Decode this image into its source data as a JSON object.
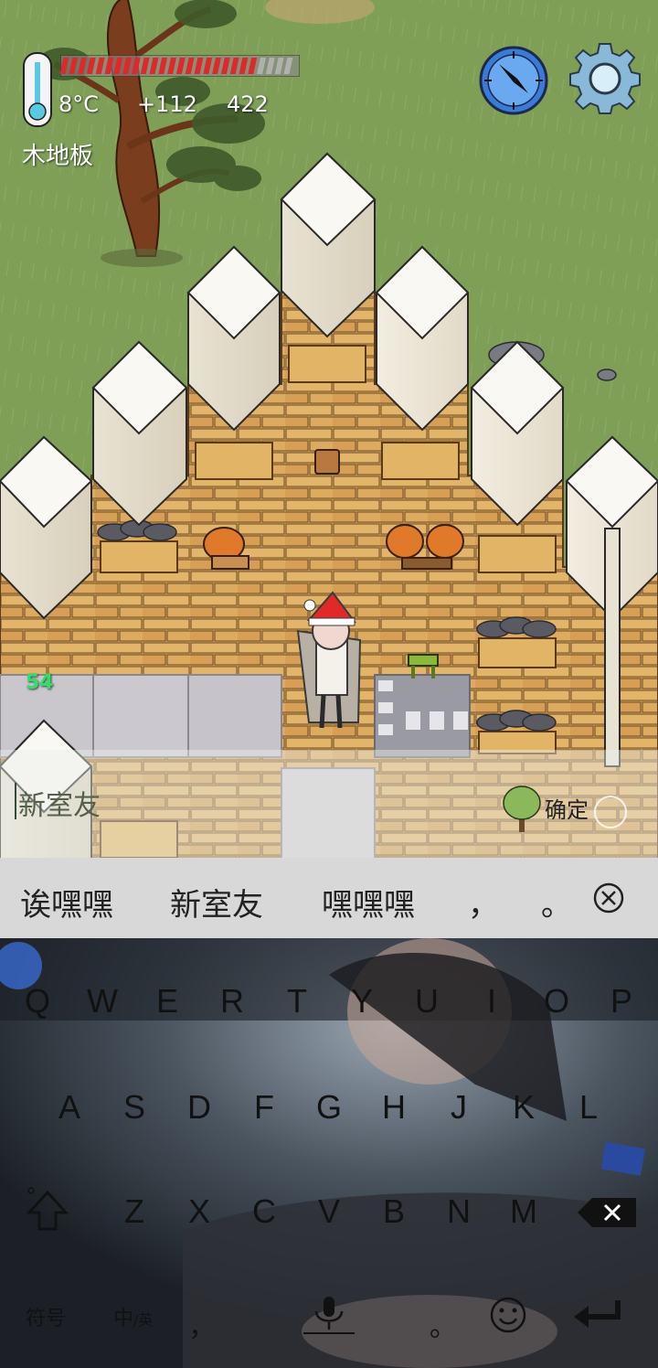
{
  "hud": {
    "temperature": "8°C",
    "food_bonus": "+112",
    "yum_count": "422",
    "tile_name": "木地板",
    "player_age": "54",
    "health_level": 0.85
  },
  "chat_input": {
    "value": "新室友",
    "confirm_label": "确定"
  },
  "ime": {
    "candidates": [
      "诶嘿嘿",
      "新室友",
      "嘿嘿嘿",
      "，",
      "。"
    ],
    "close_icon": "close-circle-icon",
    "rows": [
      [
        "Q",
        "W",
        "E",
        "R",
        "T",
        "Y",
        "U",
        "I",
        "O",
        "P"
      ],
      [
        "A",
        "S",
        "D",
        "F",
        "G",
        "H",
        "J",
        "K",
        "L"
      ],
      [
        "Z",
        "X",
        "C",
        "V",
        "B",
        "N",
        "M"
      ]
    ],
    "shift_icon": "shift-icon",
    "backspace_icon": "backspace-icon",
    "symbols_label": "符号",
    "lang_label_cn": "中",
    "lang_label_en": "/英",
    "comma_key": "，",
    "period_key": "。",
    "mic_icon": "microphone-icon",
    "emoji_icon": "emoji-icon",
    "enter_icon": "enter-icon"
  },
  "colors": {
    "grass": "#7f9f57",
    "wood_floor": "#d9a85c",
    "stone_wall": "#f1efe6",
    "candidate_bar": "#d8d8d8",
    "health_red": "#e0282c",
    "age_green": "#2ee06a"
  }
}
